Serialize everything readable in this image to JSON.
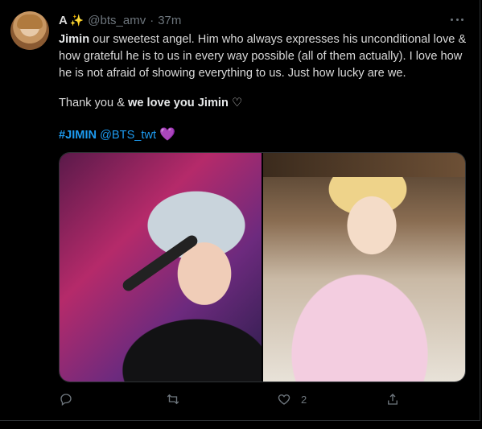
{
  "tweet": {
    "author_name": "A",
    "author_emoji": "✨",
    "handle": "@bts_amv",
    "separator": "·",
    "time": "37m",
    "line1_bold": "Jimin",
    "line1_rest": " our sweetest angel. Him who always expresses his unconditional love & how grateful he is to us in every way possible (all of them actually). I love how he is not afraid of showing everything to us. Just how lucky are we.",
    "line2_prefix": "Thank you & ",
    "line2_bold": "we love you Jimin",
    "line2_heart": " ♡",
    "hashtag": "#JIMIN",
    "mention": "@BTS_twt",
    "purple_heart": "💜",
    "like_count": "2"
  },
  "colors": {
    "background": "#000000",
    "link": "#1d9bf0",
    "muted": "#6e767d"
  },
  "icons": {
    "reply": "reply-icon",
    "retweet": "retweet-icon",
    "like": "heart-icon",
    "share": "share-icon",
    "more": "more-icon"
  }
}
